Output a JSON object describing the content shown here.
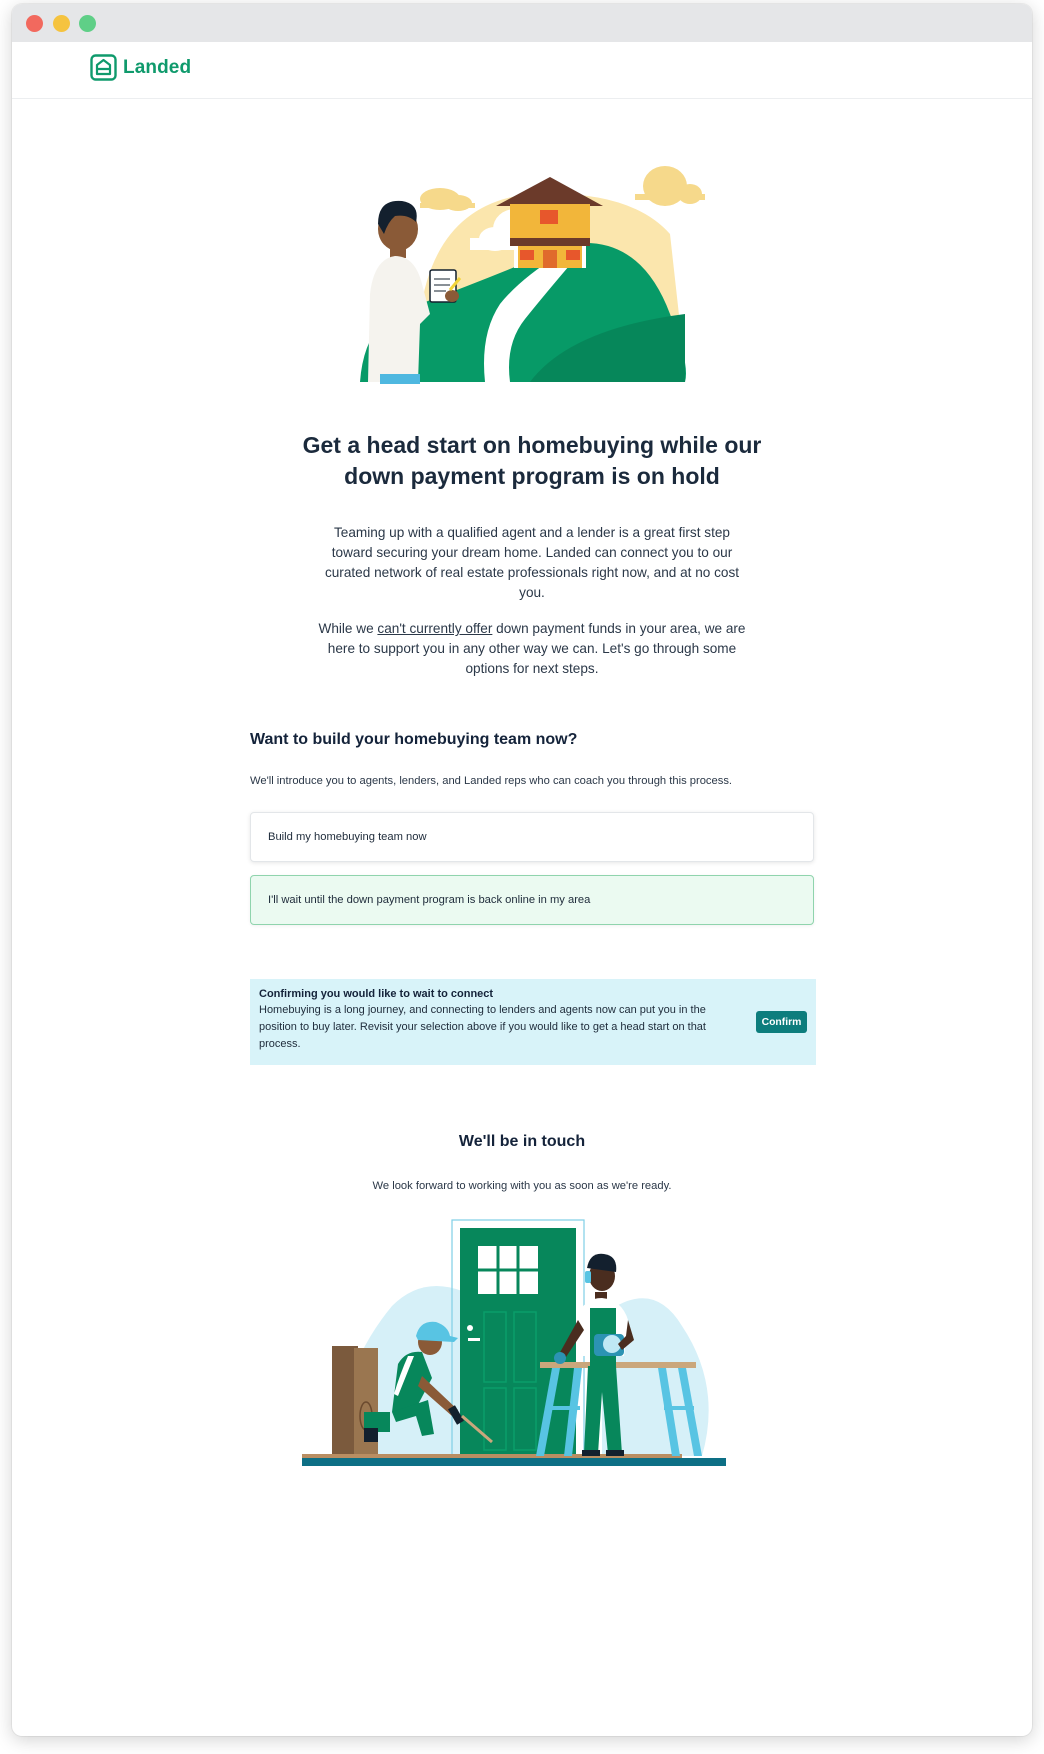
{
  "window": {
    "controls": [
      "close",
      "minimize",
      "maximize"
    ]
  },
  "brand": {
    "name": "Landed",
    "icon": "house-logo-icon",
    "color": "#0f9a6c"
  },
  "hero": {
    "illustration": "agent-with-clipboard-and-house-on-hill",
    "headline": "Get a head start on homebuying while our down payment program is on hold",
    "paragraph1": "Teaming up with a qualified agent and a lender is a great first step toward securing your dream home. Landed can connect you to our curated network of real estate professionals right now, and at no cost you.",
    "paragraph2_before": "While we ",
    "paragraph2_link": "can't currently offer",
    "paragraph2_after": " down payment funds in your area, we are here to support you in any other way we can. Let's go through some options for next steps."
  },
  "team_section": {
    "title": "Want to build your homebuying team now?",
    "description": "We'll introduce you to agents, lenders, and Landed reps who can coach you through this process.",
    "options": [
      {
        "label": "Build my homebuying team now",
        "selected": false
      },
      {
        "label": "I'll wait until the down payment program is back online in my area",
        "selected": true
      }
    ]
  },
  "notice": {
    "title": "Confirming you would like to wait to connect",
    "body": "Homebuying is a long journey, and connecting to lenders and agents now can put you in the position to buy later. Revisit your selection above if you would like to get a head start on that process.",
    "button_label": "Confirm",
    "background": "#d8f3f9",
    "button_color": "#0d7d7d"
  },
  "touch": {
    "title": "We'll be in touch",
    "description": "We look forward to working with you as soon as we're ready.",
    "illustration": "workers-building-front-door"
  }
}
